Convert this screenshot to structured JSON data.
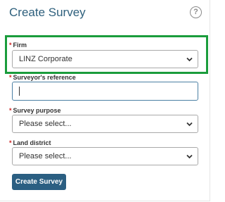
{
  "header": {
    "title": "Create Survey",
    "help_symbol": "?",
    "help_icon": "question-circle-icon"
  },
  "form": {
    "firm": {
      "required_marker": "*",
      "label": "Firm",
      "value": "LINZ Corporate"
    },
    "surveyors_reference": {
      "required_marker": "*",
      "label": "Surveyor's reference",
      "value": ""
    },
    "survey_purpose": {
      "required_marker": "*",
      "label": "Survey purpose",
      "value": "Please select..."
    },
    "land_district": {
      "required_marker": "*",
      "label": "Land district",
      "value": "Please select..."
    },
    "submit_label": "Create Survey"
  },
  "colors": {
    "title": "#2d5f7c",
    "highlight_border": "#1a9c3c",
    "required": "#cc2222",
    "button_bg": "#2b5f82"
  }
}
